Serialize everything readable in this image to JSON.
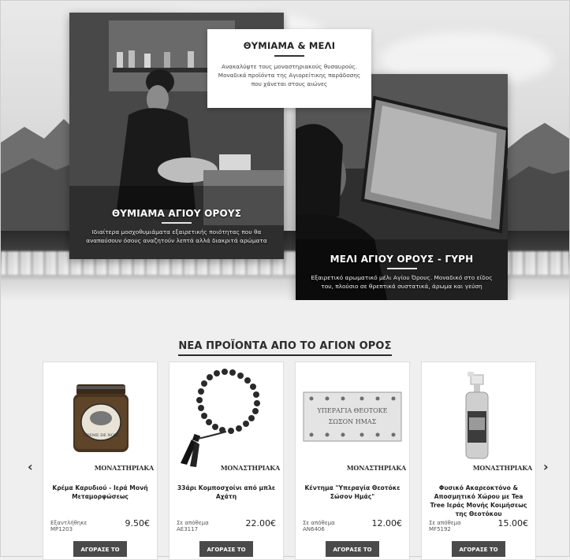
{
  "hero": {
    "main_title": "ΘΥΜΙΑΜΑ & ΜΕΛΙ",
    "main_description": "Ανακαλύψτε τους μοναστηριακούς θυσαυρούς. Μοναδικά προϊόντα της Αγιορείτικης παράδοσης που χάνεται στους αιώνες",
    "incense": {
      "title": "ΘΥΜΙΑΜΑ ΑΓΙΟΥ ΟΡΟΥΣ",
      "description": "Ιδιαίτερα μοσχοθυμιάματα εξαιρετικής ποιότητας που θα αναπαύσουν όσους αναζητούν λεπτά αλλά διακριτά αρώματα"
    },
    "honey": {
      "title": "ΜΕΛΙ ΑΓΙΟΥ ΟΡΟΥΣ - ΓΥΡΗ",
      "description": "Εξαιρετικό αρωματικό μέλι Αγίου Όρους. Μοναδικό στο είδος του, πλούσιο σε θρεπτικά συστατικά, άρωμα και γεύση"
    }
  },
  "products_section": {
    "heading": "ΝΕΑ ΠΡΟΪΟΝΤΑ ΑΠΟ ΤΟ ΑΓΙΟΝ ΟΡΟΣ",
    "prev_arrow": "‹",
    "next_arrow": "›",
    "brand": "ΜΟΝΑΣΤΗΡΙΑΚΑ",
    "buy_label": "ΑΓΟΡΑΣΕ ΤΟ",
    "products": [
      {
        "title": "Κρέμα Καρυδιού - Ιερά Μονή Μεταμορφώσεως",
        "stock": "Εξαντλήθηκε",
        "code": "MP1203",
        "price": "9.50€",
        "jar_label": "CREME DE NOIX"
      },
      {
        "title": "33άρι Κομποσχοίνι από μπλε Αχάτη",
        "stock": "Σε απόθεμα",
        "code": "AE3117",
        "price": "22.00€"
      },
      {
        "title": "Κέντημα \"Υπεραγία Θεοτόκε Σώσον Ημάς\"",
        "stock": "Σε απόθεμα",
        "code": "AN6406",
        "price": "12.00€",
        "embroidery_line1": "ΥΠΕΡΑΓΙΑ ΘΕΟΤΟΚΕ",
        "embroidery_line2": "ΣΩΣΟΝ ΗΜΑΣ"
      },
      {
        "title": "Φυσικό Ακαρεοκτόνο & Αποσμητικό Χώρου με Tea Tree Ιεράς Μονής Κοιμήσεως της Θεοτόκου",
        "stock": "Σε απόθεμα",
        "code": "MF5192",
        "price": "15.00€"
      }
    ]
  }
}
